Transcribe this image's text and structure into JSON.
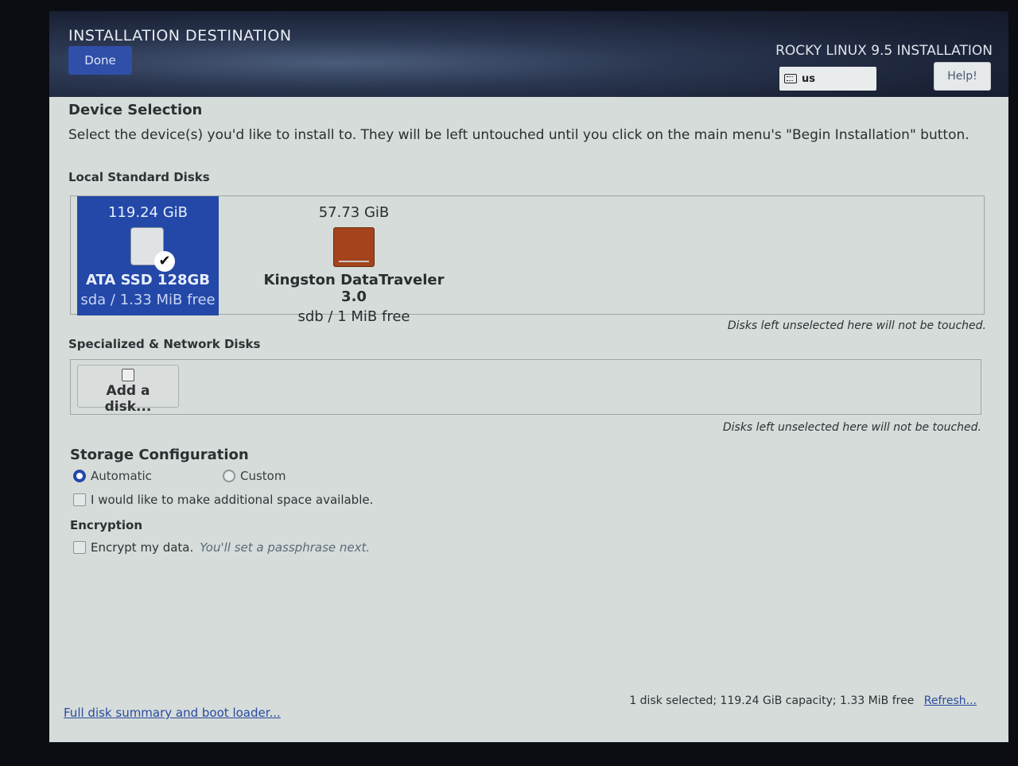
{
  "header": {
    "title": "INSTALLATION DESTINATION",
    "done_label": "Done",
    "product": "ROCKY LINUX 9.5 INSTALLATION",
    "keyboard_layout": "us",
    "help_label": "Help!"
  },
  "device_selection": {
    "heading": "Device Selection",
    "description": "Select the device(s) you'd like to install to.  They will be left untouched until you click on the main menu's \"Begin Installation\" button."
  },
  "local_disks": {
    "label": "Local Standard Disks",
    "disks": [
      {
        "capacity": "119.24 GiB",
        "name": "ATA SSD 128GB",
        "info": "sda  /  1.33 MiB free",
        "selected": true,
        "icon": "hdd-icon"
      },
      {
        "capacity": "57.73 GiB",
        "name": "Kingston DataTraveler 3.0",
        "info": "sdb    /    1 MiB free",
        "selected": false,
        "icon": "usb-drive-icon"
      }
    ],
    "note": "Disks left unselected here will not be touched."
  },
  "network_disks": {
    "label": "Specialized & Network Disks",
    "add_label": "Add a disk...",
    "note": "Disks left unselected here will not be touched."
  },
  "storage": {
    "heading": "Storage Configuration",
    "automatic_label": "Automatic",
    "custom_label": "Custom",
    "selected": "Automatic",
    "space_label": "I would like to make additional space available."
  },
  "encryption": {
    "heading": "Encryption",
    "encrypt_label": "Encrypt my data.",
    "hint": "You'll set a passphrase next."
  },
  "footer": {
    "summary_link": "Full disk summary and boot loader...",
    "status": "1 disk selected; 119.24 GiB capacity; 1.33 MiB free",
    "refresh_label": "Refresh..."
  },
  "colors": {
    "accent": "#2348a8",
    "header_bg": "#1a2236",
    "panel_bg": "#d6dcd9"
  }
}
